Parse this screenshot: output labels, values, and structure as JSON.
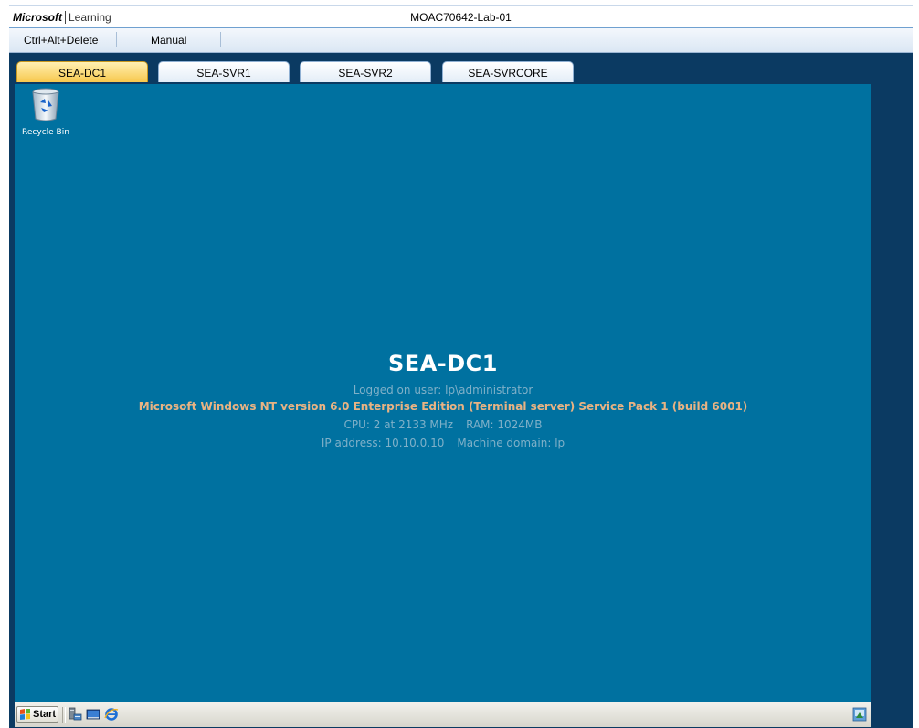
{
  "brand": {
    "company": "Microsoft",
    "product": "Learning"
  },
  "window": {
    "title": "MOAC70642-Lab-01"
  },
  "menu": {
    "ctrl_alt_delete": "Ctrl+Alt+Delete",
    "manual": "Manual"
  },
  "tabs": [
    {
      "label": "SEA-DC1",
      "active": true
    },
    {
      "label": "SEA-SVR1",
      "active": false
    },
    {
      "label": "SEA-SVR2",
      "active": false
    },
    {
      "label": "SEA-SVRCORE",
      "active": false
    }
  ],
  "desktop": {
    "recycle_bin": "Recycle Bin",
    "hostname": "SEA-DC1",
    "logged_on": "Logged on user: lp\\administrator",
    "os": "Microsoft Windows NT version 6.0 Enterprise Edition (Terminal server)  Service Pack 1 (build 6001)",
    "cpu": "CPU: 2 at 2133 MHz",
    "ram": "RAM: 1024MB",
    "ip": "IP address: 10.10.0.10",
    "domain": "Machine domain: lp"
  },
  "taskbar": {
    "start": "Start"
  },
  "icons": {
    "recycle": "recycle-bin-icon",
    "start": "windows-flag-icon",
    "quick_launch": [
      "server-manager-icon",
      "show-desktop-icon",
      "internet-explorer-icon"
    ],
    "tray": "network-tray-icon"
  },
  "colors": {
    "desktop": "#0071a0",
    "backdrop": "#0b3a62",
    "tab_active": "#f7c84d",
    "os_text": "#e9b383"
  }
}
